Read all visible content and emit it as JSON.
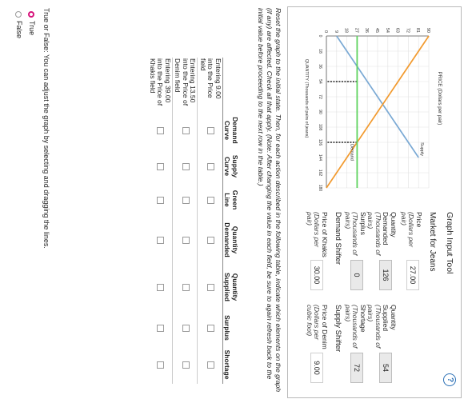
{
  "tool_title": "Graph Input Tool",
  "help_label": "?",
  "market_title": "Market for Jeans",
  "price": {
    "label": "Price",
    "unit": "(Dollars per pair)",
    "value": "27.00"
  },
  "qty_demanded": {
    "label": "Quantity Demanded",
    "unit": "(Thousands of pairs)",
    "value": "126"
  },
  "qty_supplied": {
    "label": "Quantity Supplied",
    "unit": "(Thousands of pairs)",
    "value": "54"
  },
  "surplus": {
    "label": "Surplus",
    "unit": "(Thousands of pairs)",
    "value": "0"
  },
  "shortage": {
    "label": "Shortage",
    "unit": "(Thousands of pairs)",
    "value": "72"
  },
  "demand_shifter": {
    "title": "Demand Shifter",
    "label": "Price of Khakis",
    "unit": "(Dollars per pair)",
    "value": "30.00"
  },
  "supply_shifter": {
    "title": "Supply Shifter",
    "label": "Price of Denim",
    "unit": "(Dollars per cubic foot)",
    "value": "9.00"
  },
  "chart_data": {
    "type": "line",
    "ylabel": "PRICE (Dollars per pair)",
    "xlabel": "QUANTITY (Thousands of pairs of jeans)",
    "yticks": [
      "0",
      "9",
      "18",
      "27",
      "36",
      "45",
      "54",
      "63",
      "72",
      "81",
      "90"
    ],
    "xticks": [
      "0",
      "18",
      "36",
      "54",
      "72",
      "90",
      "108",
      "126",
      "144",
      "162",
      "180"
    ],
    "xlim": [
      0,
      180
    ],
    "ylim": [
      0,
      90
    ],
    "series": [
      {
        "name": "Supply",
        "color": "#7aa9d4",
        "points": [
          [
            0,
            9
          ],
          [
            144,
            81
          ]
        ]
      },
      {
        "name": "Demand",
        "color": "#f29a2e",
        "points": [
          [
            0,
            90
          ],
          [
            180,
            0
          ]
        ]
      }
    ],
    "price_line": 27,
    "price_line_color": "#5fd35f",
    "qty_markers": [
      54,
      126
    ]
  },
  "instructions": "Reset the graph to the initial state. Then, for each action described in the following table, indicate which elements on the graph (if any) are affected. Check all that apply. (Note: After changing the value in each field, be sure to again refresh back to the initial value before proceeding to the next row in the table.)",
  "table": {
    "headers": [
      "",
      "Demand Curve",
      "Supply Curve",
      "Green Line",
      "Quantity Demanded",
      "Quantity Supplied",
      "Surplus",
      "Shortage"
    ],
    "rows": [
      "Entering 9.00 into the Price field",
      "Entering 13.50 into the Price of Denim field",
      "Entering 39.00 into the Price of Khakis field"
    ]
  },
  "tf": {
    "question": "True or False: You can adjust the graph by selecting and dragging the lines.",
    "options": [
      "True",
      "False"
    ],
    "selected": "True"
  }
}
